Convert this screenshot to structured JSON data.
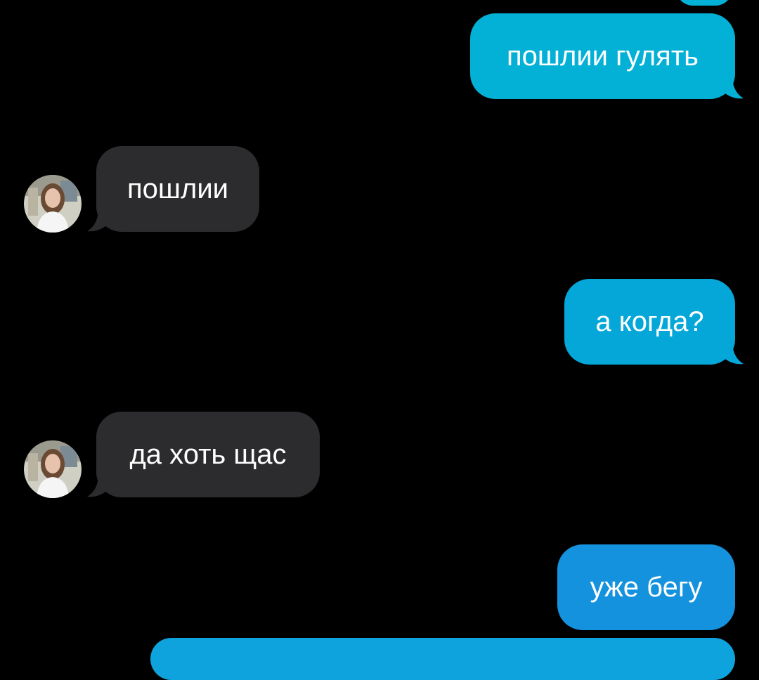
{
  "messages": [
    {
      "from": "me",
      "text": "пошлии гулять",
      "color": "#03b0d6"
    },
    {
      "from": "friend",
      "text": "пошлии",
      "avatar": "friend-avatar-icon"
    },
    {
      "from": "me",
      "text": "а когда?",
      "color": "#05a7d9"
    },
    {
      "from": "friend",
      "text": "да хоть щас",
      "avatar": "friend-avatar-icon"
    },
    {
      "from": "me",
      "text": "уже бегу",
      "color": "#1592dd"
    }
  ],
  "colors": {
    "background": "#000000",
    "incoming_bubble": "#2c2c2e",
    "outgoing_bubble_top": "#03b0d6",
    "outgoing_bubble_bottom": "#1592dd",
    "text": "#ffffff"
  }
}
